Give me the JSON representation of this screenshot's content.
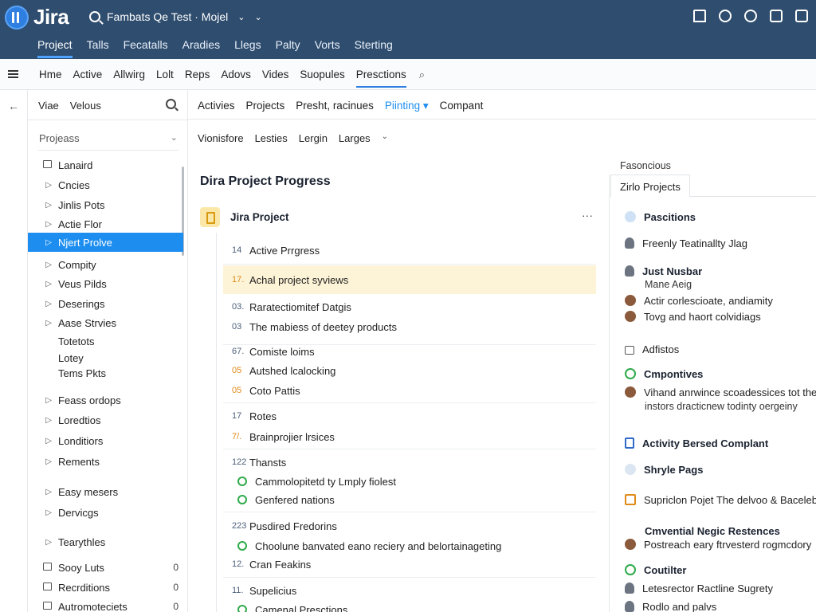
{
  "brand": {
    "name": "Jira",
    "logo_icon": "jira-logo-icon"
  },
  "search": {
    "text": "Fambats Qe Test · Mojel",
    "icon": "search-icon"
  },
  "top_icons": [
    "home-icon",
    "gear-icon",
    "chat-icon",
    "board-icon",
    "help-icon"
  ],
  "top_nav": [
    {
      "label": "Project",
      "active": true
    },
    {
      "label": "Talls"
    },
    {
      "label": "Fecatalls"
    },
    {
      "label": "Aradies"
    },
    {
      "label": "Llegs"
    },
    {
      "label": "Palty"
    },
    {
      "label": "Vorts"
    },
    {
      "label": "Sterting"
    }
  ],
  "second_nav": [
    {
      "label": "Hme"
    },
    {
      "label": "Active"
    },
    {
      "label": "Allwirg"
    },
    {
      "label": "Lolt"
    },
    {
      "label": "Reps"
    },
    {
      "label": "Adovs"
    },
    {
      "label": "Vides"
    },
    {
      "label": "Suopules"
    },
    {
      "label": "Presctions",
      "active": true
    }
  ],
  "sidebar": {
    "header": [
      "Viae",
      "Velous"
    ],
    "section_title": "Projeass",
    "items": [
      {
        "label": "Lanaird",
        "mark": "box"
      },
      {
        "label": "Cncies",
        "mark": "▷"
      },
      {
        "label": "Jinlis Pots",
        "mark": "▷"
      },
      {
        "label": "Actie Flor",
        "mark": "▷"
      },
      {
        "label": "Njert Prolve",
        "mark": "▷",
        "active": true
      },
      {
        "label": "Compity",
        "mark": "▷"
      },
      {
        "label": "Veus Pilds",
        "mark": "▷"
      },
      {
        "label": "Deserings",
        "mark": "▷"
      },
      {
        "label": "Aase Strvies",
        "mark": "▷"
      },
      {
        "label": "Totetots",
        "mark": ""
      },
      {
        "label": "Lotey",
        "mark": ""
      },
      {
        "label": "Tems Pkts",
        "mark": ""
      },
      {
        "label": "Feass ordops",
        "mark": "▷"
      },
      {
        "label": "Loredtios",
        "mark": "▷"
      },
      {
        "label": "Londitiors",
        "mark": "▷"
      },
      {
        "label": "Rements",
        "mark": "▷"
      },
      {
        "label": "Easy mesers",
        "mark": "▷"
      },
      {
        "label": "Dervicgs",
        "mark": "▷"
      },
      {
        "label": "Tearythles",
        "mark": "▷"
      },
      {
        "label": "Sooy Luts",
        "mark": "box",
        "count": "0"
      },
      {
        "label": "Recrditions",
        "mark": "box",
        "count": "0"
      },
      {
        "label": "Autromoteciets",
        "mark": "box",
        "count": "0"
      }
    ]
  },
  "tabs": [
    {
      "label": "Activies"
    },
    {
      "label": "Projects"
    },
    {
      "label": "Presht, racinues"
    },
    {
      "label": "Piinting ▾",
      "active": true
    },
    {
      "label": "Compant"
    }
  ],
  "filters": [
    "Vionisfore",
    "Lesties",
    "Lergin",
    "Larges"
  ],
  "main": {
    "title": "Dira Project Progress",
    "project_title": "Jira Project",
    "more": "···",
    "tasks": [
      {
        "num": "14",
        "text": "Active Prrgress"
      },
      {
        "num": "17.",
        "text": "Achal project syviews",
        "highlight": true,
        "orange": true
      },
      {
        "num": "03.",
        "text": "Raratectiomitef Datgis"
      },
      {
        "num": "03",
        "text": "The mabiess of deetey products"
      },
      {
        "num": "67.",
        "text": "Comiste loims"
      },
      {
        "num": "05",
        "text": "Autshed lcalocking",
        "orange": true
      },
      {
        "num": "05",
        "text": "Coto Pattis",
        "orange": true
      },
      {
        "num": "17",
        "text": "Rotes"
      },
      {
        "num": "7/.",
        "text": "Brainprojier lrsices",
        "orange": true
      },
      {
        "num": "122",
        "text": "Thansts"
      },
      {
        "num": "",
        "text": "Cammolopitetd ty Lmply fiolest",
        "check": true
      },
      {
        "num": "",
        "text": "Genfered nations",
        "check": true
      },
      {
        "num": "223",
        "text": "Pusdired Fredorins"
      },
      {
        "num": "",
        "text": "Choolune banvated eano reciery and belortainageting",
        "check": true
      },
      {
        "num": "12.",
        "text": "Cran Feakins"
      },
      {
        "num": "11.",
        "text": "Supelicius"
      },
      {
        "num": "",
        "text": "Camenal Presctions",
        "check": true
      }
    ]
  },
  "right": {
    "label": "Fasoncious",
    "tab": "Zirlo Projects",
    "items": [
      {
        "icon": "chat",
        "text": "Pascitions",
        "bold": true
      },
      {
        "icon": "person",
        "text": "Freenly Teatinallty Jlag"
      },
      {
        "icon": "person",
        "text": "Just Nusbar",
        "bold": true
      },
      {
        "icon": "",
        "text": "Mane Aeig",
        "sub": true
      },
      {
        "icon": "face",
        "text": "Actir corlescioate, andiamity"
      },
      {
        "icon": "face",
        "text": "Tovg and haort colvidiags"
      },
      {
        "icon": "box",
        "text": "Adfistos"
      },
      {
        "icon": "check",
        "text": "Cmpontives",
        "bold": true
      },
      {
        "icon": "face",
        "text": "Vihand anrwince scoadessices tot the"
      },
      {
        "icon": "",
        "text": "instors dracticnew todinty oergeiny",
        "sub": true
      },
      {
        "icon": "doc",
        "text": "Activity Bersed Complant",
        "bold": true
      },
      {
        "icon": "bubble",
        "text": "Shryle Pags",
        "bold": true
      },
      {
        "icon": "img",
        "text": "Supriclon Pojet The delvoo & Bacelebo"
      },
      {
        "icon": "",
        "text": "Cmvential Negic Restences",
        "bold": true,
        "indent": true
      },
      {
        "icon": "face",
        "text": "Postreach eary ftrvesterd rogmcdory"
      },
      {
        "icon": "check",
        "text": "Coutilter",
        "bold": true
      },
      {
        "icon": "person",
        "text": "Letesrector Ractline Sugrety"
      },
      {
        "icon": "person",
        "text": "Rodlo and palvs"
      }
    ]
  }
}
